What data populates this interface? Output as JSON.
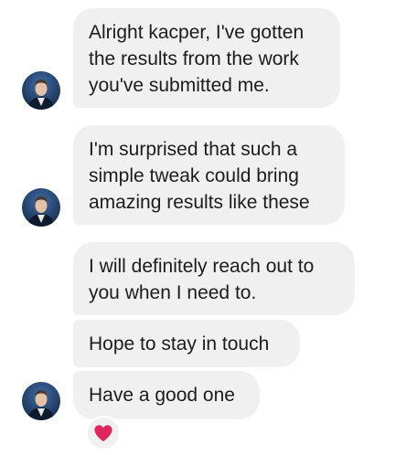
{
  "contact": {
    "avatar_icon": "person-avatar-icon"
  },
  "messages": [
    {
      "lines": [
        "Alright kacper, I've gotten",
        "the results from the work",
        "you've submitted me."
      ],
      "has_avatar": true
    },
    {
      "lines": [
        "I'm surprised that such a",
        "simple tweak could bring",
        "amazing results like these"
      ],
      "has_avatar": true
    },
    {
      "lines": [
        "I will definitely reach out to",
        "you when I need to."
      ],
      "has_avatar": false
    },
    {
      "lines": [
        "Hope to stay in touch"
      ],
      "has_avatar": false
    },
    {
      "lines": [
        "Have a good one"
      ],
      "has_avatar": true
    }
  ],
  "reaction": {
    "icon": "heart-icon",
    "color": "#e0245e"
  },
  "colors": {
    "bubble_bg": "#f0f0f0",
    "text": "#1c1c1c",
    "avatar_bg": "#1f3a63"
  }
}
